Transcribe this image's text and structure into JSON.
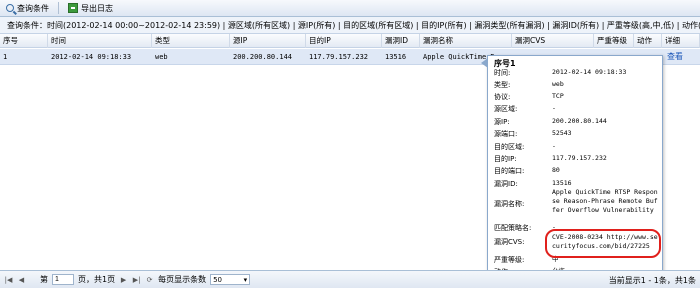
{
  "toolbar": {
    "query_label": "查询条件",
    "export_label": "导出日志"
  },
  "condition": {
    "text": "查询条件：时间(2012-02-14 00:00~2012-02-14 23:59) | 源区域(所有区域) | 源IP(所有) | 目的区域(所有区域) | 目的IP(所有) | 漏洞类型(所有漏洞) | 漏洞ID(所有) | 严重等级(高,中,低) | 动作(允许,拒绝"
  },
  "table": {
    "headers": [
      "序号",
      "时间",
      "类型",
      "源IP",
      "目的IP",
      "漏洞ID",
      "漏洞名称",
      "漏洞CVS",
      "严重等级",
      "动作",
      "详细"
    ],
    "row": [
      "1",
      "2012-02-14 09:18:33",
      "web",
      "200.200.80.144",
      "117.79.157.232",
      "13516",
      "Apple QuickTime R...",
      "",
      "",
      "",
      "查看"
    ]
  },
  "tooltip": {
    "title": "序号1",
    "fields": [
      {
        "label": "时间:",
        "value": "2012-02-14 09:18:33"
      },
      {
        "label": "类型:",
        "value": "web"
      },
      {
        "label": "协议:",
        "value": "TCP"
      },
      {
        "label": "源区域:",
        "value": "-"
      },
      {
        "label": "源IP:",
        "value": "200.200.80.144"
      },
      {
        "label": "源端口:",
        "value": "52543"
      },
      {
        "label": "目的区域:",
        "value": "-"
      },
      {
        "label": "目的IP:",
        "value": "117.79.157.232"
      },
      {
        "label": "目的端口:",
        "value": "80"
      },
      {
        "label": "漏洞ID:",
        "value": "13516"
      },
      {
        "label": "漏洞名称:",
        "value": "Apple QuickTime RTSP Response Reason-Phrase Remote Buffer Overflow Vulnerability"
      },
      {
        "label": "匹配策略名:",
        "value": "-"
      },
      {
        "label": "漏洞CVS:",
        "value": "CVE-2008-0234 http://www.securityfocus.com/bid/27225"
      },
      {
        "label": "严重等级:",
        "value": "中"
      },
      {
        "label": "动作:",
        "value": "允许"
      }
    ]
  },
  "pager": {
    "page_prefix": "第",
    "page_value": "1",
    "page_suffix": "页，共1页",
    "per_page_label": "每页显示条数",
    "per_page_value": "50",
    "info": "当前显示1 - 1条，共1条"
  },
  "colors": {
    "highlight": "#e0201c",
    "link": "#1a56b8"
  }
}
